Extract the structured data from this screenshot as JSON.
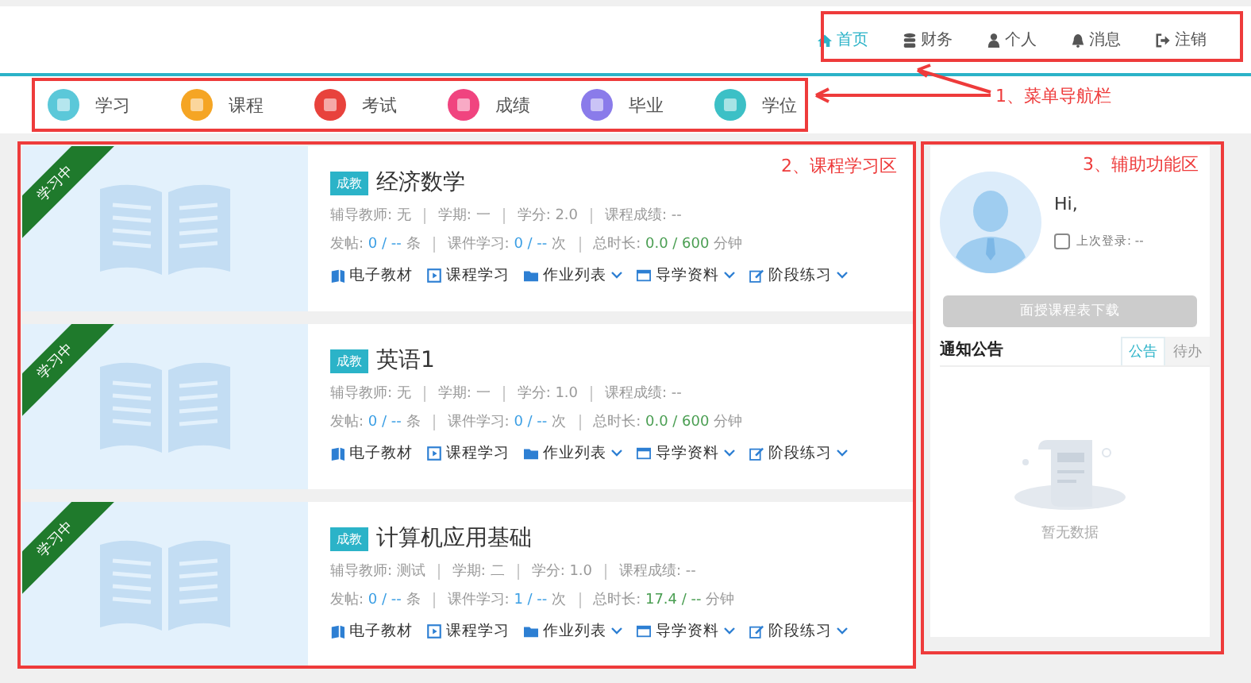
{
  "top_nav": [
    {
      "label": "首页",
      "selected": true
    },
    {
      "label": "财务",
      "selected": false
    },
    {
      "label": "个人",
      "selected": false
    },
    {
      "label": "消息",
      "selected": false
    },
    {
      "label": "注销",
      "selected": false
    }
  ],
  "menu": [
    {
      "label": "学习",
      "color": "#5bc8d9"
    },
    {
      "label": "课程",
      "color": "#f5a524"
    },
    {
      "label": "考试",
      "color": "#e8423c"
    },
    {
      "label": "成绩",
      "color": "#f0447f"
    },
    {
      "label": "毕业",
      "color": "#8a7bea"
    },
    {
      "label": "学位",
      "color": "#3cc0c6"
    }
  ],
  "courses": [
    {
      "ribbon": "学习中",
      "tag": "成教",
      "title": "经济数学",
      "info": [
        "辅导教师: 无",
        "学期: 一",
        "学分: 2.0",
        "课程成绩: --"
      ],
      "stats": [
        {
          "label": "发帖:",
          "value": "0 / --",
          "unit": "条",
          "color": "#3a9ee4"
        },
        {
          "label": "课件学习:",
          "value": "0 / --",
          "unit": "次",
          "color": "#3a9ee4"
        },
        {
          "label": "总时长:",
          "value": "0.0 / 600",
          "unit": "分钟",
          "color": "#4a9e52"
        }
      ],
      "links": [
        {
          "label": "电子教材",
          "dropdown": false
        },
        {
          "label": "课程学习",
          "dropdown": false
        },
        {
          "label": "作业列表",
          "dropdown": true
        },
        {
          "label": "导学资料",
          "dropdown": true
        },
        {
          "label": "阶段练习",
          "dropdown": true
        }
      ]
    },
    {
      "ribbon": "学习中",
      "tag": "成教",
      "title": "英语1",
      "info": [
        "辅导教师: 无",
        "学期: 一",
        "学分: 1.0",
        "课程成绩: --"
      ],
      "stats": [
        {
          "label": "发帖:",
          "value": "0 / --",
          "unit": "条",
          "color": "#3a9ee4"
        },
        {
          "label": "课件学习:",
          "value": "0 / --",
          "unit": "次",
          "color": "#3a9ee4"
        },
        {
          "label": "总时长:",
          "value": "0.0 / 600",
          "unit": "分钟",
          "color": "#4a9e52"
        }
      ],
      "links": [
        {
          "label": "电子教材",
          "dropdown": false
        },
        {
          "label": "课程学习",
          "dropdown": false
        },
        {
          "label": "作业列表",
          "dropdown": true
        },
        {
          "label": "导学资料",
          "dropdown": true
        },
        {
          "label": "阶段练习",
          "dropdown": true
        }
      ]
    },
    {
      "ribbon": "学习中",
      "tag": "成教",
      "title": "计算机应用基础",
      "info": [
        "辅导教师: 测试",
        "学期: 二",
        "学分: 1.0",
        "课程成绩: --"
      ],
      "stats": [
        {
          "label": "发帖:",
          "value": "0 / --",
          "unit": "条",
          "color": "#3a9ee4"
        },
        {
          "label": "课件学习:",
          "value": "1 / --",
          "unit": "次",
          "color": "#3a9ee4"
        },
        {
          "label": "总时长:",
          "value": "17.4 / --",
          "unit": "分钟",
          "color": "#4a9e52"
        }
      ],
      "links": [
        {
          "label": "电子教材",
          "dropdown": false
        },
        {
          "label": "课程学习",
          "dropdown": false
        },
        {
          "label": "作业列表",
          "dropdown": true
        },
        {
          "label": "导学资料",
          "dropdown": true
        },
        {
          "label": "阶段练习",
          "dropdown": true
        }
      ]
    }
  ],
  "sidebar": {
    "greeting": "Hi,",
    "last_login": "上次登录: --",
    "download_button": {
      "label": "面授课程表下载",
      "disabled": true
    },
    "notice_title": "通知公告",
    "tabs": [
      {
        "label": "公告",
        "selected": true
      },
      {
        "label": "待办",
        "selected": false
      }
    ],
    "empty_text": "暂无数据"
  },
  "annotations": [
    {
      "label": "1、菜单导航栏"
    },
    {
      "label": "2、课程学习区"
    },
    {
      "label": "3、辅助功能区"
    }
  ]
}
